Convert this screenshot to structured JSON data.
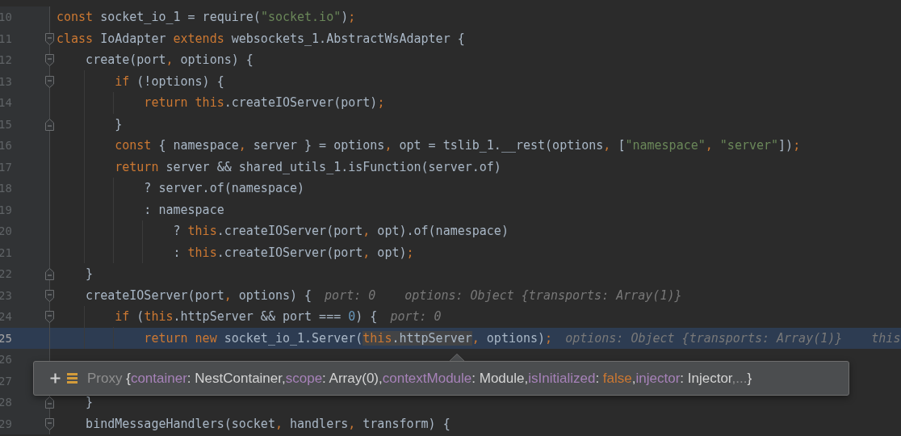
{
  "editor": {
    "lines": [
      {
        "number": "10",
        "current": false,
        "kind": "code",
        "tokens": [
          {
            "kind": "kw",
            "text": "const"
          },
          {
            "kind": "plain",
            "text": " socket_io_1 = require("
          },
          {
            "kind": "str",
            "text": "\"socket.io\""
          },
          {
            "kind": "plain",
            "text": ")"
          },
          {
            "kind": "punc",
            "text": ";"
          }
        ]
      },
      {
        "number": "11",
        "current": false,
        "kind": "block_start",
        "tokens": [
          {
            "kind": "kw",
            "text": "class"
          },
          {
            "kind": "plain",
            "text": " IoAdapter "
          },
          {
            "kind": "kw",
            "text": "extends"
          },
          {
            "kind": "plain",
            "text": " websockets_1.AbstractWsAdapter {"
          }
        ]
      },
      {
        "number": "12",
        "current": false,
        "kind": "block_start",
        "tokens": [
          {
            "kind": "plain",
            "text": "    create(port"
          },
          {
            "kind": "punc",
            "text": ","
          },
          {
            "kind": "plain",
            "text": " options) {"
          }
        ]
      },
      {
        "number": "13",
        "current": false,
        "kind": "block_start",
        "tokens": [
          {
            "kind": "kw",
            "text": "        if"
          },
          {
            "kind": "plain",
            "text": " (!options) {"
          }
        ]
      },
      {
        "number": "14",
        "current": false,
        "kind": "code",
        "tokens": [
          {
            "kind": "kw",
            "text": "            return this"
          },
          {
            "kind": "plain",
            "text": ".createIOServer(port)"
          },
          {
            "kind": "punc",
            "text": ";"
          }
        ]
      },
      {
        "number": "15",
        "current": false,
        "kind": "block_end",
        "tokens": [
          {
            "kind": "plain",
            "text": "        }"
          }
        ]
      },
      {
        "number": "16",
        "current": false,
        "kind": "code",
        "tokens": [
          {
            "kind": "kw",
            "text": "        const"
          },
          {
            "kind": "plain",
            "text": " { namespace"
          },
          {
            "kind": "punc",
            "text": ","
          },
          {
            "kind": "plain",
            "text": " server } = options"
          },
          {
            "kind": "punc",
            "text": ","
          },
          {
            "kind": "plain",
            "text": " opt = tslib_1.__rest(options"
          },
          {
            "kind": "punc",
            "text": ","
          },
          {
            "kind": "plain",
            "text": " ["
          },
          {
            "kind": "str",
            "text": "\"namespace\""
          },
          {
            "kind": "punc",
            "text": ", "
          },
          {
            "kind": "str",
            "text": "\"server\""
          },
          {
            "kind": "plain",
            "text": "])"
          },
          {
            "kind": "punc",
            "text": ";"
          }
        ]
      },
      {
        "number": "17",
        "current": false,
        "kind": "code",
        "tokens": [
          {
            "kind": "kw",
            "text": "        return"
          },
          {
            "kind": "plain",
            "text": " server && shared_utils_1.isFunction(server.of)"
          }
        ]
      },
      {
        "number": "18",
        "current": false,
        "kind": "code",
        "tokens": [
          {
            "kind": "plain",
            "text": "            ? server.of(namespace)"
          }
        ]
      },
      {
        "number": "19",
        "current": false,
        "kind": "code",
        "tokens": [
          {
            "kind": "plain",
            "text": "            : namespace"
          }
        ]
      },
      {
        "number": "20",
        "current": false,
        "kind": "code",
        "tokens": [
          {
            "kind": "plain",
            "text": "                ? "
          },
          {
            "kind": "kw",
            "text": "this"
          },
          {
            "kind": "plain",
            "text": ".createIOServer(port"
          },
          {
            "kind": "punc",
            "text": ","
          },
          {
            "kind": "plain",
            "text": " opt).of(namespace)"
          }
        ]
      },
      {
        "number": "21",
        "current": false,
        "kind": "code",
        "tokens": [
          {
            "kind": "plain",
            "text": "                : "
          },
          {
            "kind": "kw",
            "text": "this"
          },
          {
            "kind": "plain",
            "text": ".createIOServer(port"
          },
          {
            "kind": "punc",
            "text": ","
          },
          {
            "kind": "plain",
            "text": " opt)"
          },
          {
            "kind": "punc",
            "text": ";"
          }
        ]
      },
      {
        "number": "22",
        "current": false,
        "kind": "block_end",
        "tokens": [
          {
            "kind": "plain",
            "text": "    }"
          }
        ]
      },
      {
        "number": "23",
        "current": false,
        "kind": "block_start",
        "tokens": [
          {
            "kind": "plain",
            "text": "    createIOServer(port"
          },
          {
            "kind": "punc",
            "text": ","
          },
          {
            "kind": "plain",
            "text": " options) {"
          }
        ],
        "hints": [
          "port: 0",
          "options: Object {transports: Array(1)}"
        ]
      },
      {
        "number": "24",
        "current": false,
        "kind": "block_start",
        "tokens": [
          {
            "kind": "kw",
            "text": "        if"
          },
          {
            "kind": "plain",
            "text": " ("
          },
          {
            "kind": "kw",
            "text": "this"
          },
          {
            "kind": "plain",
            "text": ".httpServer && port === "
          },
          {
            "kind": "num",
            "text": "0"
          },
          {
            "kind": "plain",
            "text": ") {"
          }
        ],
        "hints": [
          "port: 0"
        ]
      },
      {
        "number": "25",
        "current": true,
        "kind": "code",
        "tokens": [
          {
            "kind": "kw",
            "text": "            return new"
          },
          {
            "kind": "plain",
            "text": " socket_io_1.Server("
          },
          {
            "kind": "group",
            "hovered": true,
            "tokens": [
              {
                "kind": "kw",
                "text": "this"
              },
              {
                "kind": "plain",
                "text": ".httpServer"
              }
            ]
          },
          {
            "kind": "punc",
            "text": ","
          },
          {
            "kind": "plain",
            "text": " options)"
          },
          {
            "kind": "punc",
            "text": ";"
          }
        ],
        "hints": [
          "options: Object {transports: Array(1)}",
          "this"
        ]
      },
      {
        "number": "26",
        "current": false,
        "kind": "code"
      },
      {
        "number": "27",
        "current": false,
        "kind": "code"
      },
      {
        "number": "28",
        "current": false,
        "kind": "block_end",
        "tokens": [
          {
            "kind": "plain",
            "text": "    }"
          }
        ]
      },
      {
        "number": "29",
        "current": false,
        "kind": "block_start",
        "tokens": [
          {
            "kind": "plain",
            "text": "    bindMessageHandlers(socket"
          },
          {
            "kind": "punc",
            "text": ","
          },
          {
            "kind": "plain",
            "text": " handlers"
          },
          {
            "kind": "punc",
            "text": ","
          },
          {
            "kind": "plain",
            "text": " transform) {"
          }
        ]
      }
    ]
  },
  "tooltip": {
    "type_name": "Proxy",
    "tokens": [
      {
        "kind": "brace",
        "text": "{"
      },
      {
        "kind": "key",
        "text": "container"
      },
      {
        "kind": "sep",
        "text": ": NestContainer,"
      },
      {
        "kind": "key",
        "text": "scope"
      },
      {
        "kind": "sep",
        "text": ": Array(0),"
      },
      {
        "kind": "key",
        "text": "contextModule"
      },
      {
        "kind": "sep",
        "text": ": Module,"
      },
      {
        "kind": "key",
        "text": "isInitialized"
      },
      {
        "kind": "sep",
        "text": ": "
      },
      {
        "kind": "bool",
        "text": "false"
      },
      {
        "kind": "sep",
        "text": ","
      },
      {
        "kind": "key",
        "text": "injector"
      },
      {
        "kind": "sep",
        "text": ": Injector"
      },
      {
        "kind": "more",
        "text": ",..."
      },
      {
        "kind": "brace",
        "text": "}"
      }
    ]
  }
}
